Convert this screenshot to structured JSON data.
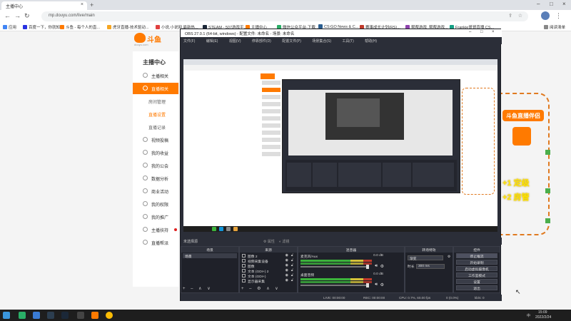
{
  "browser": {
    "tab_title": "主播中心",
    "url": "mp.douyu.com/live/main",
    "bookmarks": [
      "应用",
      "百度一下，你就知道",
      "斗鱼 - 每个人的直...",
      "虎牙直播-技术驱动...",
      "小说,小说网,最新热...",
      "STEAM - 507游戏平...",
      "主播中心",
      "微信公众平台-下载...",
      "CS:GO News & C...",
      "赛事成长计划(RS)...",
      "帮帮游戏_帮帮游戏...",
      "Frankie哥哥直播 CS...",
      "阅读清单"
    ],
    "colors": {
      "tabbar": "#dee1e6"
    }
  },
  "douyu": {
    "logo_text": "斗鱼",
    "logo_sub": "douyu.com",
    "sidebar_title": "主播中心",
    "items": [
      {
        "label": "主播相关",
        "icon": "user-icon"
      },
      {
        "label": "直播相关",
        "icon": "live-icon",
        "active": true
      },
      {
        "label": "房间管理",
        "sub": true
      },
      {
        "label": "直播设置",
        "sub": true,
        "highlight": true
      },
      {
        "label": "直播记录",
        "sub": true
      },
      {
        "label": "视频投稿",
        "icon": "video-icon"
      },
      {
        "label": "我的收益",
        "icon": "coin-icon"
      },
      {
        "label": "我的公会",
        "icon": "guild-icon"
      },
      {
        "label": "数据分析",
        "icon": "chart-icon"
      },
      {
        "label": "商业活动",
        "icon": "briefcase-icon"
      },
      {
        "label": "我的权限",
        "icon": "key-icon"
      },
      {
        "label": "我的推广",
        "icon": "megaphone-icon"
      },
      {
        "label": "主播扶持",
        "icon": "support-icon",
        "dot": true
      },
      {
        "label": "直播帮派",
        "icon": "group-icon"
      }
    ],
    "accent": "#ff7a00"
  },
  "overlay": {
    "badge": "斗鱼直播伴侣",
    "line1": "+1 定级",
    "line2": "+2 房管"
  },
  "obs": {
    "title": "OBS 27.0.1 (64-bit, windows) - 配置文件: 未命名 - 场景: 未命名",
    "menu": [
      "文件(F)",
      "编辑(E)",
      "视图(V)",
      "停靠部件(D)",
      "配置文件(P)",
      "场景集合(S)",
      "工具(T)",
      "帮助(H)"
    ],
    "scene_header": "未选择源",
    "scene_header_right": [
      "属性",
      "滤镜"
    ],
    "panels": {
      "scenes": "场景",
      "sources": "来源",
      "mixer": "混音器",
      "transitions": "转场特效",
      "controls": "控件"
    },
    "scene_list": [
      "场景"
    ],
    "sources": [
      "图像 2",
      "视频采集设备",
      "图像",
      "文本 (GDI+) 2",
      "文本 (GDI+)",
      "显示器采集"
    ],
    "mixer": [
      {
        "name": "麦克风/Aux",
        "db": "0.0 dB"
      },
      {
        "name": "桌面音频",
        "db": "0.0 dB"
      }
    ],
    "transition": {
      "type": "渐变",
      "duration_label": "时长",
      "duration": "300 ms"
    },
    "controls": [
      "停止推流",
      "开始录制",
      "启动虚拟摄像机",
      "工作室模式",
      "设置",
      "退出"
    ],
    "status": {
      "live": "LIVE: 00:00:00",
      "rec": "REC: 00:00:00",
      "cpu": "CPU: 0.7%, 60.00 fps",
      "dropped": "0 (0.0%)",
      "kbps": "kb/s: 0"
    }
  },
  "taskbar": {
    "time": "15:09",
    "date": "2022/2/24",
    "lang": "中"
  }
}
